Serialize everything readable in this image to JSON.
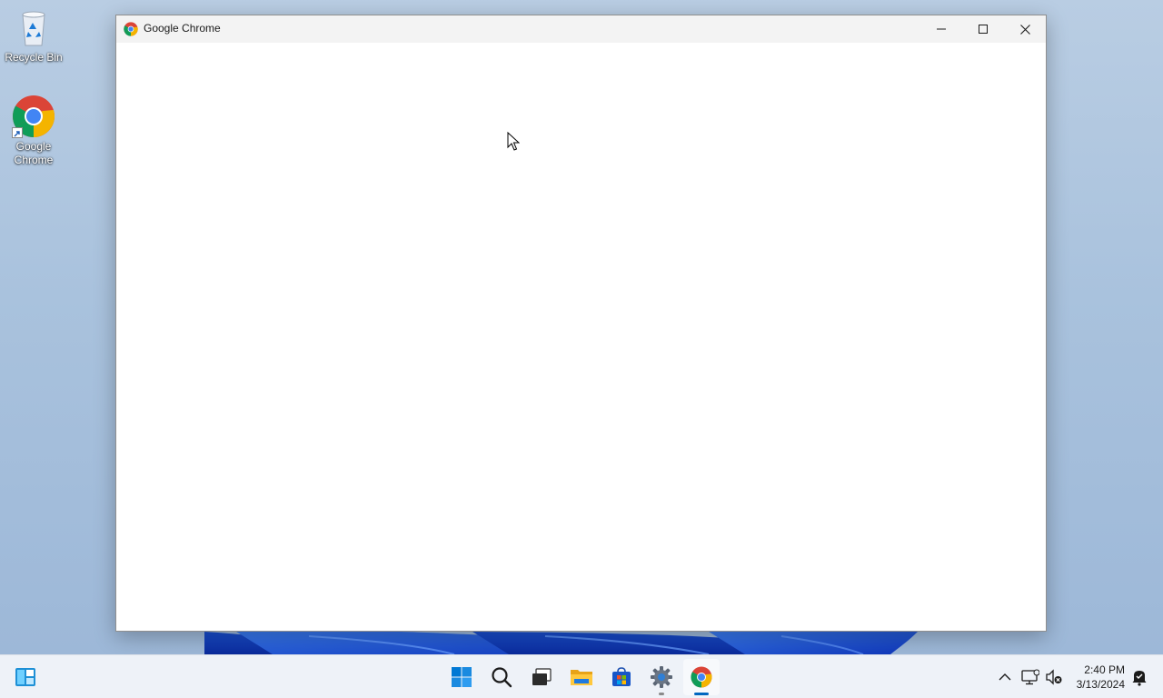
{
  "desktop": {
    "icons": [
      {
        "label": "Recycle Bin",
        "icon": "recycle-bin-icon"
      },
      {
        "label": "Google Chrome",
        "icon": "chrome-icon"
      }
    ]
  },
  "window": {
    "title": "Google Chrome",
    "icon": "chrome-icon",
    "controls": [
      "minimize",
      "maximize",
      "close"
    ]
  },
  "taskbar": {
    "widgets_icon": "widgets-icon",
    "apps": [
      {
        "name": "Start",
        "icon": "windows-start-icon"
      },
      {
        "name": "Search",
        "icon": "search-icon"
      },
      {
        "name": "Task View",
        "icon": "task-view-icon"
      },
      {
        "name": "File Explorer",
        "icon": "file-explorer-icon"
      },
      {
        "name": "Microsoft Store",
        "icon": "store-icon"
      },
      {
        "name": "Settings",
        "icon": "settings-gear-icon",
        "running": true
      },
      {
        "name": "Google Chrome",
        "icon": "chrome-icon",
        "running": true,
        "active": true
      }
    ],
    "tray": {
      "icons": [
        "chevron-up-icon",
        "network-icon",
        "volume-muted-icon",
        "notification-icon"
      ],
      "time": "2:40 PM",
      "date": "3/13/2024"
    }
  },
  "colors": {
    "accent": "#0067c0",
    "chrome_red": "#db4437",
    "chrome_green": "#0f9d58",
    "chrome_yellow": "#f4b400",
    "chrome_blue": "#4285f4",
    "taskbar_bg": "#eef2f8"
  }
}
